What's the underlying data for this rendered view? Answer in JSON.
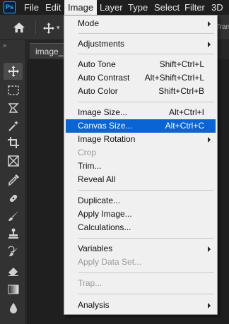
{
  "app": {
    "logo_text": "Ps"
  },
  "menubar": [
    "File",
    "Edit",
    "Image",
    "Layer",
    "Type",
    "Select",
    "Filter",
    "3D"
  ],
  "options_bar": {
    "trailing_text": "Tran"
  },
  "document": {
    "tab_label": "image_s"
  },
  "toolbar": {
    "collapse_glyph": "»",
    "tools": [
      "move-icon",
      "marquee-icon",
      "lasso-icon",
      "magic-wand-icon",
      "crop-icon",
      "frame-icon",
      "eyedropper-icon",
      "healing-brush-icon",
      "brush-icon",
      "stamp-icon",
      "history-brush-icon",
      "eraser-icon",
      "gradient-icon",
      "blur-icon"
    ]
  },
  "image_menu": {
    "items": [
      {
        "label": "Mode",
        "shortcut": "",
        "submenu": true,
        "disabled": false
      },
      {
        "label": "Adjustments",
        "shortcut": "",
        "submenu": true,
        "disabled": false
      },
      {
        "label": "Auto Tone",
        "shortcut": "Shift+Ctrl+L",
        "submenu": false,
        "disabled": false
      },
      {
        "label": "Auto Contrast",
        "shortcut": "Alt+Shift+Ctrl+L",
        "submenu": false,
        "disabled": false
      },
      {
        "label": "Auto Color",
        "shortcut": "Shift+Ctrl+B",
        "submenu": false,
        "disabled": false
      },
      {
        "label": "Image Size...",
        "shortcut": "Alt+Ctrl+I",
        "submenu": false,
        "disabled": false
      },
      {
        "label": "Canvas Size...",
        "shortcut": "Alt+Ctrl+C",
        "submenu": false,
        "disabled": false,
        "highlighted": true
      },
      {
        "label": "Image Rotation",
        "shortcut": "",
        "submenu": true,
        "disabled": false
      },
      {
        "label": "Crop",
        "shortcut": "",
        "submenu": false,
        "disabled": true
      },
      {
        "label": "Trim...",
        "shortcut": "",
        "submenu": false,
        "disabled": false
      },
      {
        "label": "Reveal All",
        "shortcut": "",
        "submenu": false,
        "disabled": false
      },
      {
        "label": "Duplicate...",
        "shortcut": "",
        "submenu": false,
        "disabled": false
      },
      {
        "label": "Apply Image...",
        "shortcut": "",
        "submenu": false,
        "disabled": false
      },
      {
        "label": "Calculations...",
        "shortcut": "",
        "submenu": false,
        "disabled": false
      },
      {
        "label": "Variables",
        "shortcut": "",
        "submenu": true,
        "disabled": false
      },
      {
        "label": "Apply Data Set...",
        "shortcut": "",
        "submenu": false,
        "disabled": true
      },
      {
        "label": "Trap...",
        "shortcut": "",
        "submenu": false,
        "disabled": true
      },
      {
        "label": "Analysis",
        "shortcut": "",
        "submenu": true,
        "disabled": false
      }
    ]
  },
  "colors": {
    "highlight": "#0a64d4",
    "menu_bg": "#f0f0f0",
    "app_bg": "#282828"
  }
}
